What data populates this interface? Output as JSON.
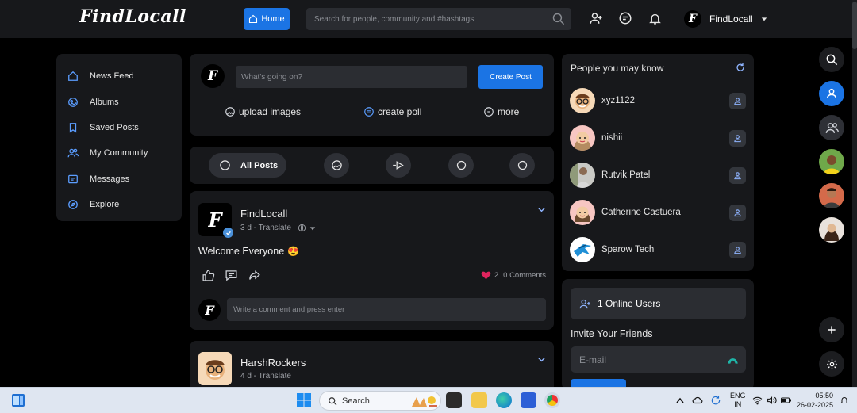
{
  "header": {
    "logo": "FindLocall",
    "home_label": "Home",
    "search_placeholder": "Search for people, community and #hashtags",
    "username": "FindLocall"
  },
  "sidebar": {
    "items": [
      {
        "label": "News Feed",
        "icon": "home-icon"
      },
      {
        "label": "Albums",
        "icon": "albums-icon"
      },
      {
        "label": "Saved Posts",
        "icon": "bookmark-icon"
      },
      {
        "label": "My Community",
        "icon": "community-icon"
      },
      {
        "label": "Messages",
        "icon": "messages-icon"
      },
      {
        "label": "Explore",
        "icon": "compass-icon"
      }
    ]
  },
  "composer": {
    "placeholder": "What's going on?",
    "create_label": "Create Post",
    "actions": [
      {
        "label": "upload images",
        "icon": "image-icon"
      },
      {
        "label": "create poll",
        "icon": "poll-icon"
      },
      {
        "label": "more",
        "icon": "plus-circle-icon"
      }
    ]
  },
  "filters": {
    "all_label": "All Posts"
  },
  "posts": [
    {
      "author": "FindLocall",
      "meta": "3 d - Translate",
      "text": "Welcome Everyone",
      "emoji": "😍",
      "likes": "2",
      "comments": "0 Comments",
      "comment_placeholder": "Write a comment and press enter"
    },
    {
      "author": "HarshRockers",
      "meta": "4 d - Translate"
    }
  ],
  "people": {
    "title": "People you may know",
    "list": [
      {
        "name": "xyz1122"
      },
      {
        "name": "nishii"
      },
      {
        "name": "Rutvik Patel"
      },
      {
        "name": "Catherine Castuera"
      },
      {
        "name": "Sparow Tech"
      }
    ]
  },
  "online": {
    "label": "1 Online Users",
    "invite_title": "Invite Your Friends",
    "email_placeholder": "E-mail"
  },
  "taskbar": {
    "search_label": "Search",
    "lang_top": "ENG",
    "lang_bottom": "IN",
    "time": "05:50",
    "date": "26-02-2025"
  },
  "colors": {
    "accent": "#1b74e4",
    "card": "#17181b",
    "input": "#2b2d32",
    "like_heart": "#e0245e"
  }
}
